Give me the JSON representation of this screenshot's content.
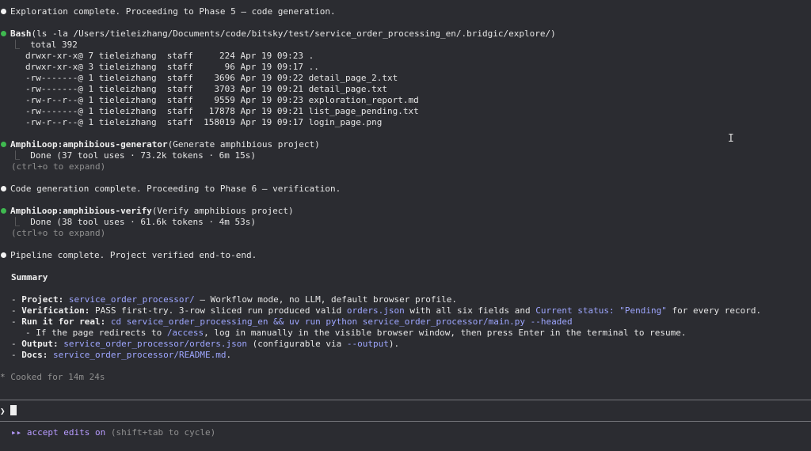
{
  "terminal": {
    "msg_exploration": "Exploration complete. Proceeding to Phase 5 — code generation.",
    "bash_tool": "Bash",
    "bash_args": "(ls -la /Users/tieleizhang/Documents/code/bitsky/test/service_order_processing_en/.bridgic/explore/)",
    "bash_total": "total 392",
    "ls_rows": [
      "drwxr-xr-x@ 7 tieleizhang  staff     224 Apr 19 09:23 .",
      "drwxr-xr-x@ 3 tieleizhang  staff      96 Apr 19 09:17 ..",
      "-rw-------@ 1 tieleizhang  staff    3696 Apr 19 09:22 detail_page_2.txt",
      "-rw-------@ 1 tieleizhang  staff    3703 Apr 19 09:21 detail_page.txt",
      "-rw-r--r--@ 1 tieleizhang  staff    9559 Apr 19 09:23 exploration_report.md",
      "-rw-------@ 1 tieleizhang  staff   17878 Apr 19 09:21 list_page_pending.txt",
      "-rw-r--r--@ 1 tieleizhang  staff  158019 Apr 19 09:17 login_page.png"
    ],
    "gen_tool": "AmphiLoop:amphibious-generator",
    "gen_args": "(Generate amphibious project)",
    "gen_done": "Done (37 tool uses · 73.2k tokens · 6m 15s)",
    "expand_hint": "(ctrl+o to expand)",
    "msg_codegen": "Code generation complete. Proceeding to Phase 6 — verification.",
    "verify_tool": "AmphiLoop:amphibious-verify",
    "verify_args": "(Verify amphibious project)",
    "verify_done": "Done (38 tool uses · 61.6k tokens · 4m 53s)",
    "msg_pipeline": "Pipeline complete. Project verified end-to-end.",
    "summary_title": "Summary",
    "project_label": "Project:",
    "project_code": "service_order_processor/",
    "project_rest": " — Workflow mode, no LLM, default browser profile.",
    "verif_label": "Verification:",
    "verif_text1": " PASS first-try. 3-row sliced run produced valid ",
    "verif_code1": "orders.json",
    "verif_text2": " with all six fields and ",
    "verif_code2": "Current status: \"Pending\"",
    "verif_text3": " for every record.",
    "run_label": "Run it for real:",
    "run_code": "cd service_order_processing_en && uv run python service_order_processor/main.py --headed",
    "note_text1": "- If the page redirects to ",
    "note_code": "/access",
    "note_text2": ", log in manually in the visible browser window, then press Enter in the terminal to resume.",
    "output_label": "Output:",
    "output_code1": "service_order_processor/orders.json",
    "output_text1": " (configurable via ",
    "output_code2": "--output",
    "output_text2": ").",
    "docs_label": "Docs:",
    "docs_code": "service_order_processor/README.md",
    "docs_text": ".",
    "cooked_icon": "*",
    "cooked": "Cooked for 14m 24s"
  },
  "prompt": {
    "glyph": "❯",
    "value": ""
  },
  "mode_bar": {
    "icon": "▸▸",
    "mode": "accept edits on",
    "hint": "(shift+tab to cycle)"
  },
  "colors": {
    "background": "#2b2c31",
    "success_dot": "#3fb950",
    "code_accent": "#9ea6ff",
    "mode_accent": "#b79bff"
  }
}
